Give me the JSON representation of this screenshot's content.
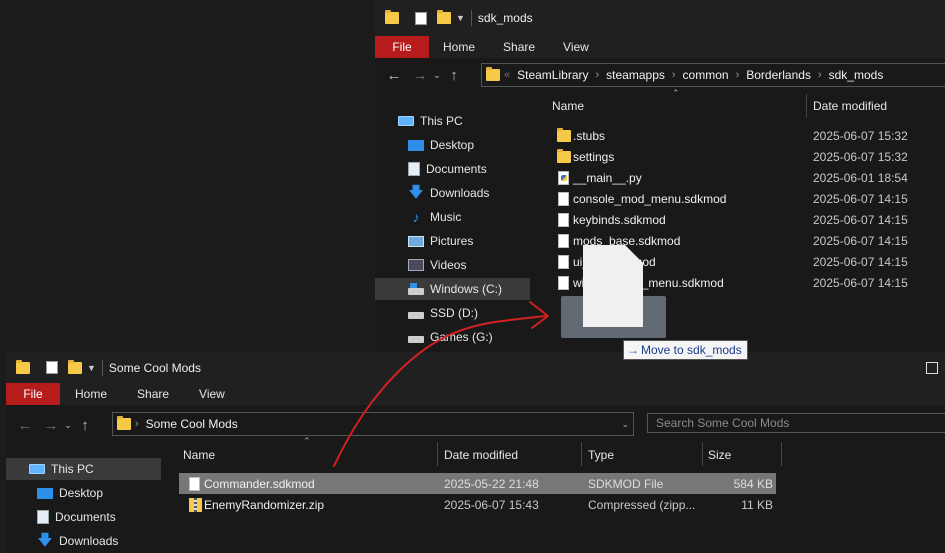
{
  "top_window": {
    "title": "sdk_mods",
    "ribbon": {
      "file": "File",
      "tabs": [
        "Home",
        "Share",
        "View"
      ]
    },
    "breadcrumb": [
      "SteamLibrary",
      "steamapps",
      "common",
      "Borderlands",
      "sdk_mods"
    ],
    "breadcrumb_overflow": "«",
    "nav": [
      {
        "label": "This PC",
        "icon": "computer-icon"
      },
      {
        "label": "Desktop",
        "icon": "desktop-icon"
      },
      {
        "label": "Documents",
        "icon": "documents-icon"
      },
      {
        "label": "Downloads",
        "icon": "downloads-icon"
      },
      {
        "label": "Music",
        "icon": "music-icon"
      },
      {
        "label": "Pictures",
        "icon": "pictures-icon"
      },
      {
        "label": "Videos",
        "icon": "videos-icon"
      },
      {
        "label": "Windows (C:)",
        "icon": "drive-c-icon",
        "selected": true
      },
      {
        "label": "SSD (D:)",
        "icon": "drive-icon"
      },
      {
        "label": "Games (G:)",
        "icon": "drive-icon"
      }
    ],
    "columns": {
      "name": "Name",
      "date": "Date modified"
    },
    "files": [
      {
        "name": ".stubs",
        "date": "2025-06-07 15:32",
        "icon": "folder-icon"
      },
      {
        "name": "settings",
        "date": "2025-06-07 15:32",
        "icon": "folder-icon"
      },
      {
        "name": "__main__.py",
        "date": "2025-06-01 18:54",
        "icon": "python-file-icon"
      },
      {
        "name": "console_mod_menu.sdkmod",
        "date": "2025-06-07 14:15",
        "icon": "file-icon"
      },
      {
        "name": "keybinds.sdkmod",
        "date": "2025-06-07 14:15",
        "icon": "file-icon"
      },
      {
        "name": "mods_base.sdkmod",
        "date": "2025-06-07 14:15",
        "icon": "file-icon"
      },
      {
        "name": "ui_utils.sdkmod",
        "date": "2025-06-07 14:15",
        "icon": "file-icon"
      },
      {
        "name": "willow1_mod_menu.sdkmod",
        "date": "2025-06-07 14:15",
        "icon": "file-icon"
      }
    ]
  },
  "drag_tooltip": {
    "arrow": "→",
    "text": "Move to sdk_mods"
  },
  "bottom_window": {
    "title": "Some Cool Mods",
    "ribbon": {
      "file": "File",
      "tabs": [
        "Home",
        "Share",
        "View"
      ]
    },
    "breadcrumb": [
      "Some Cool Mods"
    ],
    "search_placeholder": "Search Some Cool Mods",
    "nav": [
      {
        "label": "This PC",
        "icon": "computer-icon",
        "selected": true
      },
      {
        "label": "Desktop",
        "icon": "desktop-icon"
      },
      {
        "label": "Documents",
        "icon": "documents-icon"
      },
      {
        "label": "Downloads",
        "icon": "downloads-icon"
      }
    ],
    "columns": {
      "name": "Name",
      "date": "Date modified",
      "type": "Type",
      "size": "Size"
    },
    "files": [
      {
        "name": "Commander.sdkmod",
        "date": "2025-05-22 21:48",
        "type": "SDKMOD File",
        "size": "584 KB",
        "icon": "file-icon",
        "selected": true
      },
      {
        "name": "EnemyRandomizer.zip",
        "date": "2025-06-07 15:43",
        "type": "Compressed (zipp...",
        "size": "11 KB",
        "icon": "zip-icon"
      }
    ]
  },
  "colors": {
    "accent_file_tab": "#b71c1c",
    "annotation_arrow": "#d32020",
    "selection": "#777777"
  }
}
